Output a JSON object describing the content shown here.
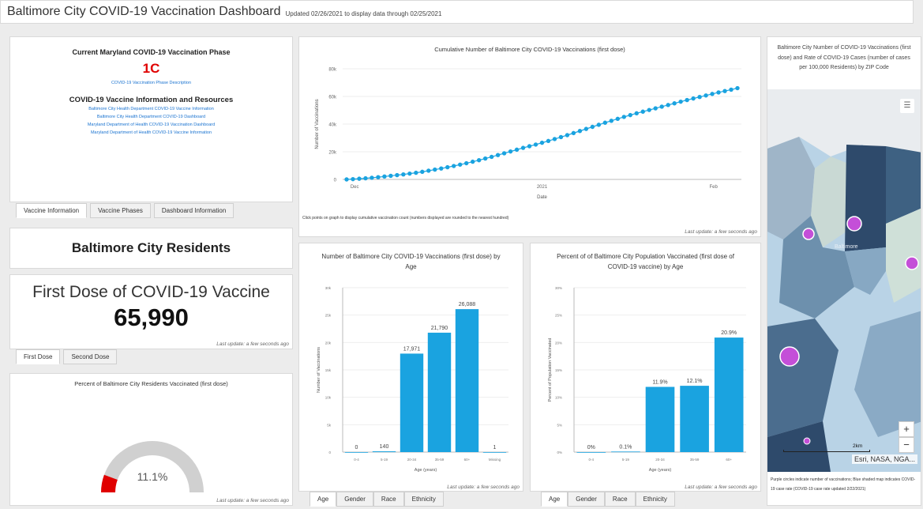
{
  "header": {
    "title": "Baltimore City COVID-19 Vaccination Dashboard",
    "updated": "Updated 02/26/2021 to display data through 02/25/2021"
  },
  "phase_panel": {
    "title": "Current Maryland COVID-19 Vaccination Phase",
    "phase": "1C",
    "phase_link": "COVID-19 Vaccination Phase Description",
    "resources_title": "COVID-19 Vaccine Information and Resources",
    "links": [
      "Baltimore City Health Department COVID-19 Vaccine Information",
      "Baltimore City Health Department COVID-19 Dashboard",
      "Maryland Department of Health COVID-19 Vaccination Dashboard",
      "Maryland Department of Health COVID-19 Vaccine Information"
    ],
    "tabs": [
      "Vaccine Information",
      "Vaccine Phases",
      "Dashboard Information"
    ]
  },
  "residents": {
    "label": "Baltimore City Residents"
  },
  "first_dose": {
    "title": "First Dose of COVID-19 Vaccine",
    "value": "65,990",
    "last_update": "Last update: a few seconds ago",
    "tabs": [
      "First Dose",
      "Second Dose"
    ]
  },
  "gauge": {
    "title": "Percent of Baltimore City Residents Vaccinated (first dose)",
    "value_label": "11.1%",
    "fraction": 0.111,
    "last_update": "Last update: a few seconds ago",
    "color_fill": "#e00000",
    "color_track": "#d0d0d0"
  },
  "cumulative": {
    "title": "Cumulative Number of Baltimore City COVID-19 Vaccinations (first dose)",
    "note": "Click points on graph to display cumulative vaccination count (numbers displayed are rounded to the nearest hundred)",
    "last_update": "Last update: a few seconds ago"
  },
  "age_count": {
    "title_line1": "Number of Baltimore City COVID-19 Vaccinations (first dose) by",
    "title_line2": "Age",
    "last_update": "Last update: a few seconds ago",
    "tabs": [
      "Age",
      "Gender",
      "Race",
      "Ethnicity"
    ]
  },
  "age_percent": {
    "title_line1": "Percent of of Baltimore City Population Vaccinated (first dose of",
    "title_line2": "COVID-19 vaccine) by Age",
    "last_update": "Last update: a few seconds ago",
    "tabs": [
      "Age",
      "Gender",
      "Race",
      "Ethnicity"
    ]
  },
  "map": {
    "title": "Baltimore City Number of COVID-19 Vaccinations (first dose) and Rate of COVID-19 Cases (number of cases per 100,000 Residents) by ZIP Code",
    "place_label": "Baltimore",
    "scale_label": "2km",
    "attribution": "Esri, NASA, NGA...",
    "zoom_in": "+",
    "zoom_out": "−",
    "legend_text": "Purple circles indicate number of vaccinations; Blue shaded map indicates COVID-19 case rate (COVID-19 case rate updated 2/22/2021)"
  },
  "chart_data": [
    {
      "type": "line",
      "title": "Cumulative Number of Baltimore City COVID-19 Vaccinations (first dose)",
      "xlabel": "Date",
      "ylabel": "Number of Vaccinations",
      "x_tick_labels": [
        "Dec",
        "2021",
        "Feb"
      ],
      "y_tick_labels": [
        "0",
        "20k",
        "40k",
        "60k",
        "80k"
      ],
      "ylim": [
        0,
        80000
      ],
      "series": [
        {
          "color": "#1aa3e0",
          "values": [
            0,
            200,
            500,
            800,
            1200,
            1600,
            2100,
            2600,
            3100,
            3600,
            4200,
            4800,
            5500,
            6300,
            7100,
            7900,
            8800,
            9700,
            10700,
            11700,
            12800,
            13900,
            15100,
            16300,
            17600,
            18900,
            20200,
            21500,
            22800,
            24000,
            25200,
            26500,
            27800,
            29200,
            30600,
            32000,
            33500,
            35000,
            36500,
            38000,
            39500,
            41000,
            42400,
            43800,
            45200,
            46500,
            47800,
            49000,
            50200,
            51400,
            52600,
            53800,
            55000,
            56200,
            57400,
            58500,
            59600,
            60700,
            61800,
            62900,
            63900,
            64900,
            65990
          ]
        }
      ]
    },
    {
      "type": "bar",
      "title": "Number of Baltimore City COVID-19 Vaccinations (first dose) by Age",
      "xlabel": "Age (years)",
      "ylabel": "Number of Vaccinations",
      "categories": [
        "0-4",
        "5-19",
        "20-34",
        "35-59",
        "60+",
        "Missing"
      ],
      "values": [
        0,
        140,
        17971,
        21790,
        26088,
        1
      ],
      "value_labels": [
        "0",
        "140",
        "17,971",
        "21,790",
        "26,088",
        "1"
      ],
      "y_tick_labels": [
        "0",
        "5k",
        "10k",
        "15k",
        "20k",
        "25k",
        "30k"
      ],
      "ylim": [
        0,
        30000
      ],
      "color": "#1aa3e0"
    },
    {
      "type": "bar",
      "title": "Percent of of Baltimore City Population Vaccinated (first dose of COVID-19 vaccine) by Age",
      "xlabel": "Age (years)",
      "ylabel": "Percent of Population Vaccinated",
      "categories": [
        "0-4",
        "5-19",
        "20-34",
        "35-59",
        "60+"
      ],
      "values": [
        0,
        0.1,
        11.9,
        12.1,
        20.9
      ],
      "value_labels": [
        "0%",
        "0.1%",
        "11.9%",
        "12.1%",
        "20.9%"
      ],
      "y_tick_labels": [
        "0%",
        "5%",
        "10%",
        "15%",
        "20%",
        "25%",
        "30%"
      ],
      "ylim": [
        0,
        30
      ],
      "color": "#1aa3e0"
    }
  ]
}
